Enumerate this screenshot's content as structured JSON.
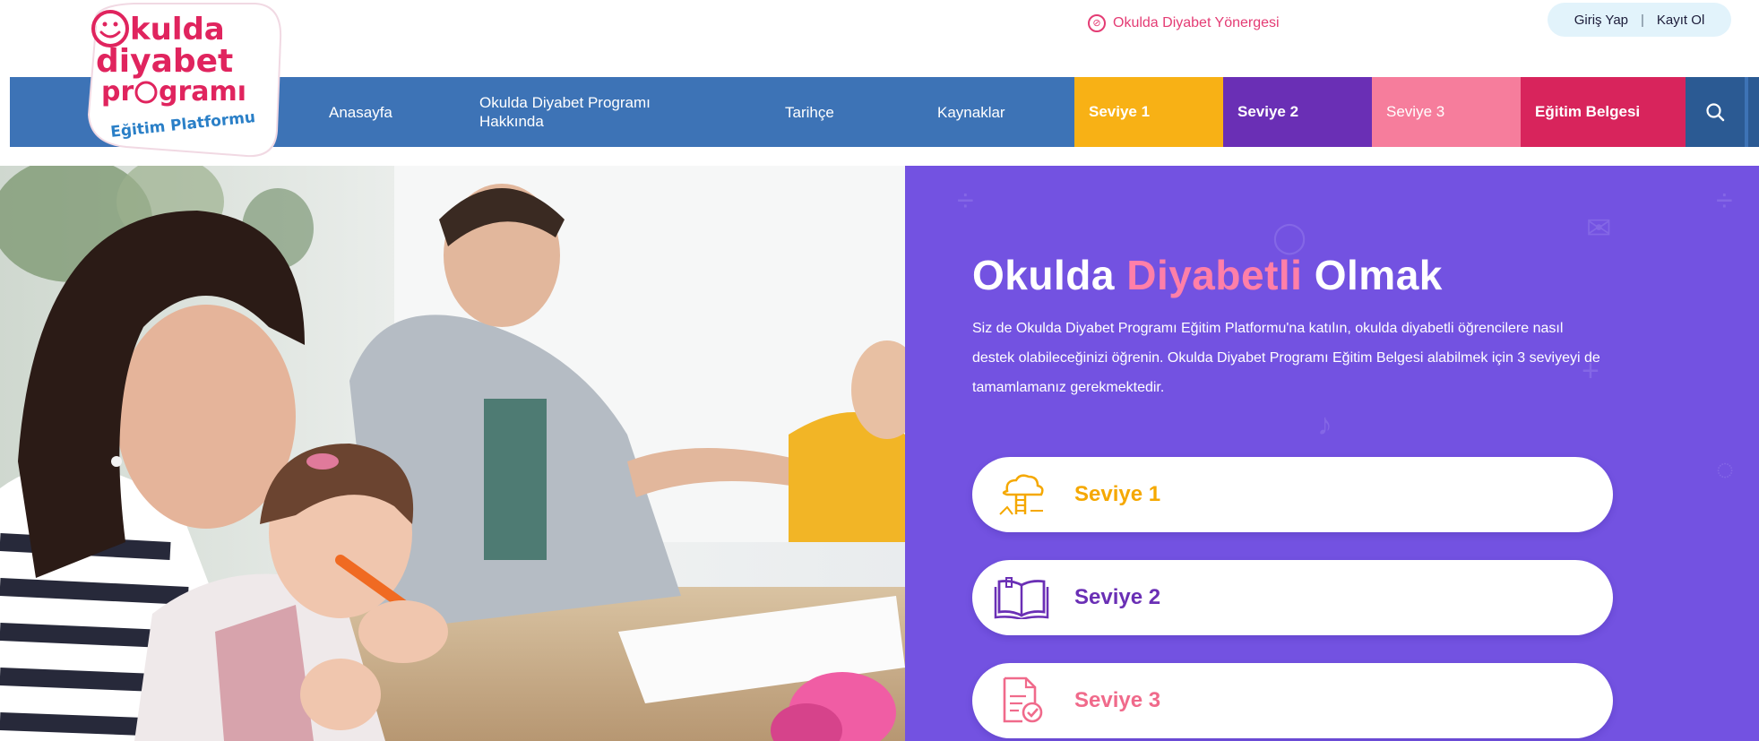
{
  "logo": {
    "line1": "Okulda",
    "line2": "diyabet",
    "line3": "programı",
    "line4": "Eğitim Platformu"
  },
  "topbar": {
    "guide_label": "Okulda Diyabet Yönergesi",
    "login": "Giriş Yap",
    "separator": "|",
    "register": "Kayıt Ol"
  },
  "nav": {
    "home": "Anasayfa",
    "about_line1": "Okulda Diyabet Programı",
    "about_line2": "Hakkında",
    "history": "Tarihçe",
    "resources": "Kaynaklar",
    "level1": "Seviye 1",
    "level2": "Seviye 2",
    "level3": "Seviye 3",
    "certificate": "Eğitim Belgesi",
    "search_icon": "search-icon"
  },
  "hero": {
    "title_part1": "Okulda ",
    "title_accent": "Diyabetli",
    "title_part2": " Olmak",
    "description": "Siz de Okulda Diyabet Programı Eğitim Platformu'na katılın, okulda diyabetli öğrencilere nasıl destek olabileceğinizi öğrenin. Okulda Diyabet Programı Eğitim Belgesi alabilmek için 3 seviyeyi de tamamlamanız gerekmektedir."
  },
  "levels": [
    {
      "label": "Seviye 1",
      "icon": "cloud-ladder-icon",
      "color": "#f5a800"
    },
    {
      "label": "Seviye 2",
      "icon": "open-book-icon",
      "color": "#6a2fb5"
    },
    {
      "label": "Seviye 3",
      "icon": "checked-document-icon",
      "color": "#f06a8b"
    }
  ],
  "colors": {
    "nav_blue": "#3d73b6",
    "level1": "#f8b115",
    "level2": "#6a2fb5",
    "level3": "#f67d9c",
    "certificate": "#d8245c",
    "panel_purple": "#7352e1",
    "accent_pink": "#ff7fa8"
  }
}
